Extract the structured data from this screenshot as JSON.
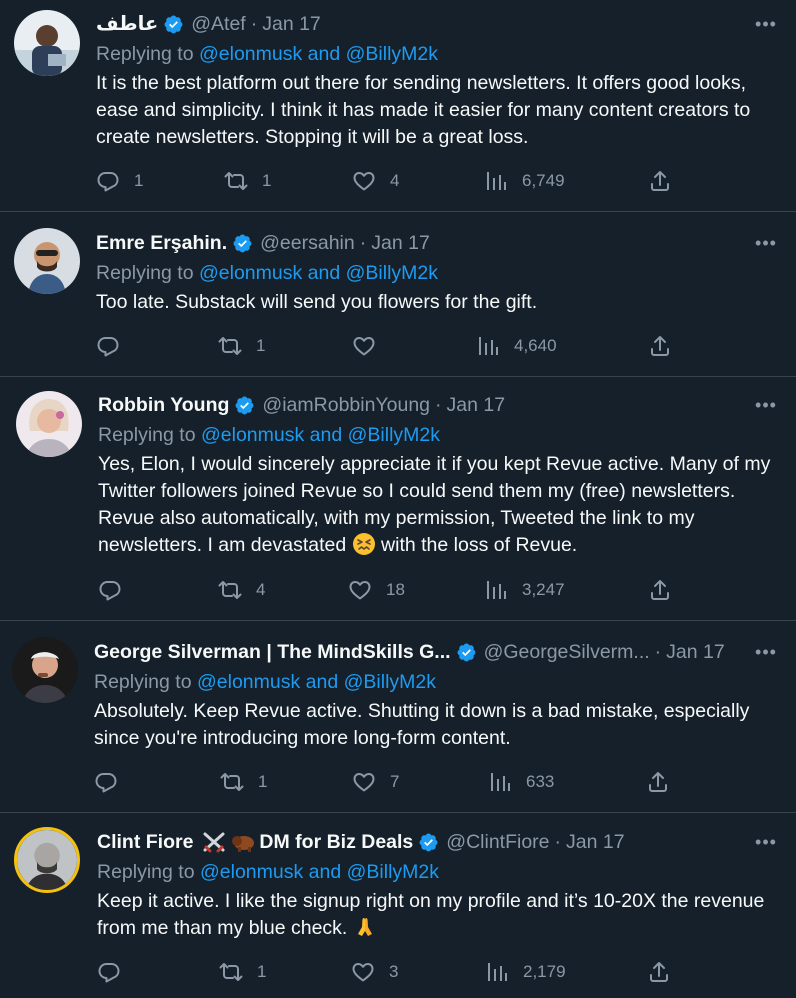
{
  "tweets": [
    {
      "name": "عاطف",
      "handle": "@Atef",
      "date": "Jan 17",
      "replying_prefix": "Replying to ",
      "replying_to": "@elonmusk and @BillyM2k",
      "text": "It is the best platform out there for sending newsletters. It offers good looks, ease and simplicity. I think it has made it easier for many content creators to create newsletters. Stopping it will be a great loss.",
      "replies": "1",
      "retweets": "1",
      "likes": "4",
      "views": "6,749"
    },
    {
      "name": "Emre Erşahin.",
      "handle": "@eersahin",
      "date": "Jan 17",
      "replying_prefix": "Replying to ",
      "replying_to": "@elonmusk and @BillyM2k",
      "text": "Too late. Substack will send you flowers for the gift.",
      "replies": "",
      "retweets": "1",
      "likes": "",
      "views": "4,640"
    },
    {
      "name": "Robbin Young",
      "handle": "@iamRobbinYoung",
      "date": "Jan 17",
      "replying_prefix": "Replying to ",
      "replying_to": "@elonmusk and @BillyM2k",
      "text_before_emoji": "Yes, Elon, I would sincerely appreciate it if you kept Revue active. Many of my Twitter followers joined Revue so I could send them my (free) newsletters. Revue also automatically, with my permission, Tweeted the link to my newsletters. I am devastated ",
      "text_after_emoji": " with the loss of Revue.",
      "replies": "",
      "retweets": "4",
      "likes": "18",
      "views": "3,247"
    },
    {
      "name": "George Silverman | The MindSkills G...",
      "handle": "@GeorgeSilverm...",
      "date": "Jan 17",
      "replying_prefix": "Replying to ",
      "replying_to": "@elonmusk and @BillyM2k",
      "text": "Absolutely. Keep Revue active. Shutting it down is a bad mistake, especially since you're introducing more long-form content.",
      "replies": "",
      "retweets": "1",
      "likes": "7",
      "views": "633"
    },
    {
      "name_part1": "Clint Fiore",
      "name_part2": "DM for Biz Deals",
      "handle": "@ClintFiore",
      "date": "Jan 17",
      "replying_prefix": "Replying to ",
      "replying_to": "@elonmusk and @BillyM2k",
      "text_before_emoji": "Keep it active. I like the signup right on my profile and it’s 10-20X the revenue from me than my blue check. ",
      "replies": "",
      "retweets": "1",
      "likes": "3",
      "views": "2,179"
    }
  ],
  "ui": {
    "more_glyph": "•••",
    "date_sep": "·",
    "accent_color": "#1d9bf0",
    "background": "#15202b",
    "muted_color": "#8b98a5"
  }
}
